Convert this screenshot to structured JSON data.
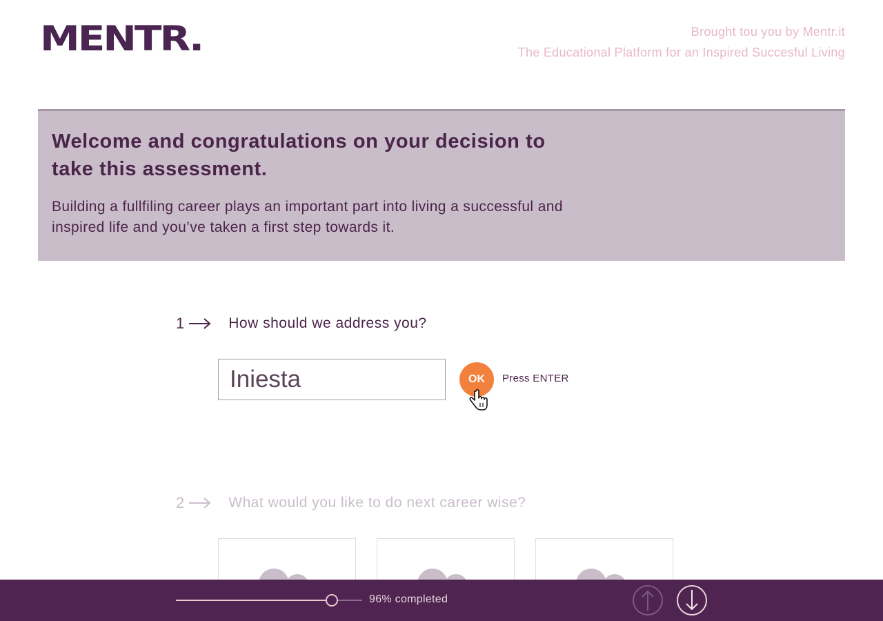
{
  "header": {
    "logo": "MENTR.",
    "tagline_line1": "Brought tou you by Mentr.it",
    "tagline_line2": "The Educational Platform for an Inspired Succesful Living"
  },
  "hero": {
    "title": "Welcome and congratulations on your decision to take this assessment.",
    "subtitle": "Building a fullfiling career plays an important part into living a successful and inspired life and you’ve taken a first step towards it."
  },
  "question1": {
    "number": "1",
    "text": "How should we address you?",
    "input_value": "Iniesta",
    "ok_label": "OK",
    "hint": "Press ENTER"
  },
  "question2": {
    "number": "2",
    "text": "What would you like to do next career wise?"
  },
  "footer": {
    "progress_percent": 96,
    "progress_label": "96% completed",
    "up_icon": "arrow-up-icon",
    "down_icon": "arrow-down-icon"
  },
  "colors": {
    "brand_purple": "#4f2451",
    "hero_bg": "#c9bdca",
    "accent_orange": "#f2813d",
    "tagline_pink": "#e8b8c6"
  }
}
